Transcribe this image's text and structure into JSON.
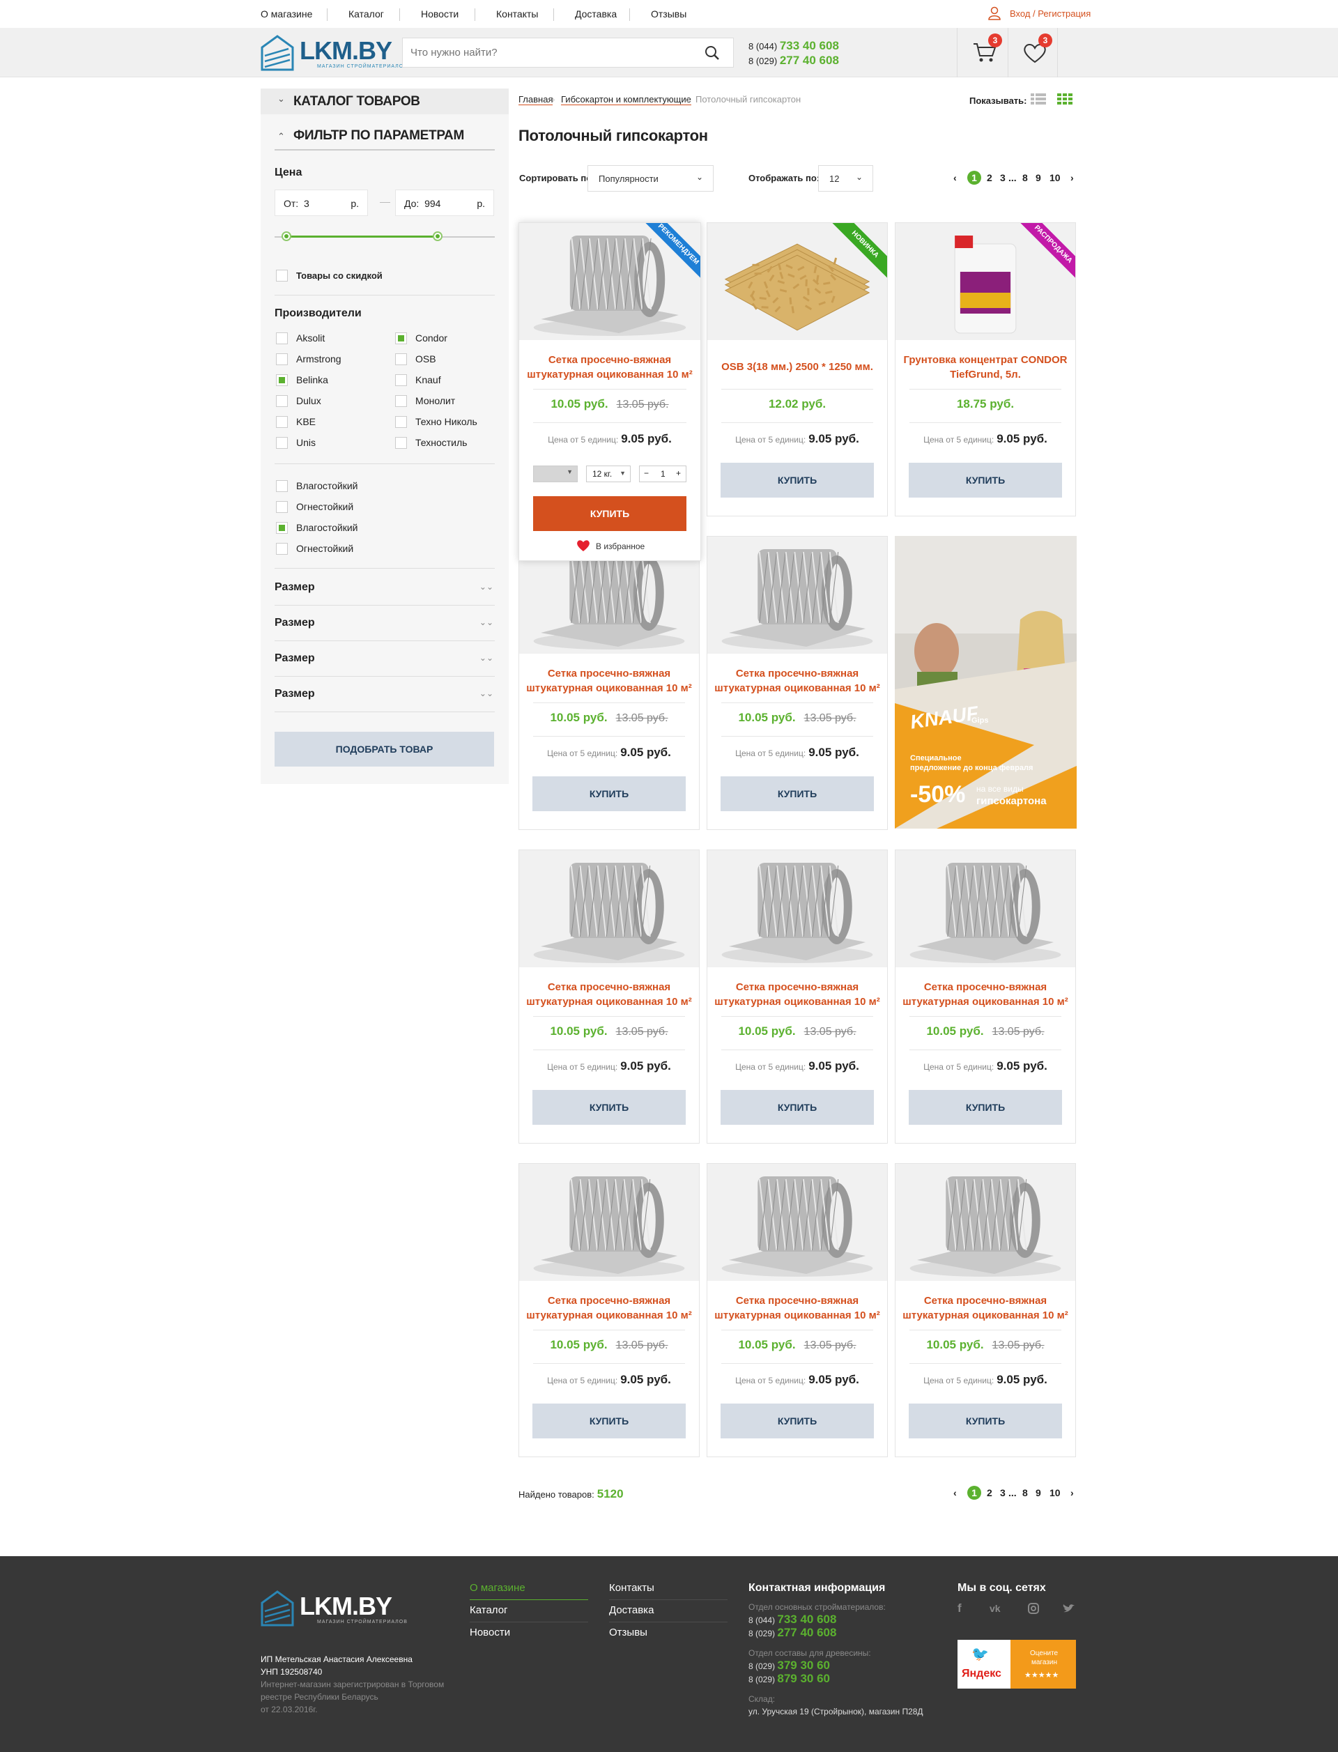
{
  "nav": {
    "items": [
      "О магазине",
      "Каталог",
      "Новости",
      "Контакты",
      "Доставка",
      "Отзывы"
    ],
    "login": "Вход / Регистрация"
  },
  "header": {
    "logo": "LKM.BY",
    "logo_sub": "МАГАЗИН СТРОЙМАТЕРИАЛОВ",
    "search_placeholder": "Что нужно найти?",
    "phone1_code": "8 (044)",
    "phone1_num": "733 40 608",
    "phone2_code": "8 (029)",
    "phone2_num": "277 40 608",
    "cart_count": "3",
    "fav_count": "3"
  },
  "sidebar": {
    "catalog_title": "КАТАЛОГ ТОВАРОВ",
    "filter_title": "ФИЛЬТР ПО ПАРАМЕТРАМ",
    "price_title": "Цена",
    "price_from_label": "От:",
    "price_from": "3",
    "price_to_label": "До:",
    "price_to": "994",
    "currency": "р.",
    "discount_label": "Товары со скидкой",
    "makers_title": "Производители",
    "makers_left": [
      {
        "name": "Aksolit",
        "on": false
      },
      {
        "name": "Armstrong",
        "on": false
      },
      {
        "name": "Belinka",
        "on": true
      },
      {
        "name": "Dulux",
        "on": false
      },
      {
        "name": "KBE",
        "on": false
      },
      {
        "name": "Unis",
        "on": false
      }
    ],
    "makers_right": [
      {
        "name": "Condor",
        "on": true
      },
      {
        "name": "OSB",
        "on": false
      },
      {
        "name": "Knauf",
        "on": false
      },
      {
        "name": "Монолит",
        "on": false
      },
      {
        "name": "Техно Николь",
        "on": false
      },
      {
        "name": "Техностиль",
        "on": false
      }
    ],
    "props": [
      {
        "name": "Влагостойкий",
        "on": false
      },
      {
        "name": "Огнестойкий",
        "on": false
      },
      {
        "name": "Влагостойкий",
        "on": true
      },
      {
        "name": "Огнестойкий",
        "on": false
      }
    ],
    "size_rows": [
      "Размер",
      "Размер",
      "Размер",
      "Размер"
    ],
    "pick_button": "ПОДОБРАТЬ ТОВАР"
  },
  "breadcrumbs": [
    "Главная",
    "Гибсокартон и комплектующие",
    "Потолочный гипсокартон"
  ],
  "show_label": "Показывать:",
  "page_title": "Потолочный гипсокартон",
  "sort_label": "Сортировать по:",
  "sort_value": "Популярности",
  "per_page_label": "Отображать по:",
  "per_page_value": "12",
  "pagination": {
    "prev": "‹",
    "pages": [
      "1",
      "2",
      "3",
      "...",
      "8",
      "9",
      "10"
    ],
    "next": "›",
    "current": "1"
  },
  "common": {
    "bulk_label": "Цена от 5 единиц:",
    "buy": "КУПИТЬ"
  },
  "hover": {
    "variant": "",
    "weight": "12 кг.",
    "qty": "1",
    "minus": "−",
    "plus": "+",
    "buy": "КУПИТЬ",
    "fav": "В избранное"
  },
  "products": [
    {
      "name": "Сетка просечно-вяжная штукатурная оцикованная 10 м²",
      "price": "10.05 руб.",
      "old": "13.05 руб.",
      "bulk": "9.05 руб.",
      "ribbon": "Рекомендуем",
      "ribbon_color": "#1e7fd6",
      "img": "mesh"
    },
    {
      "name": "OSB 3(18 мм.) 2500 * 1250 мм.",
      "price": "12.02 руб.",
      "old": "",
      "bulk": "9.05 руб.",
      "ribbon": "Новинка",
      "ribbon_color": "#3aa823",
      "img": "osb"
    },
    {
      "name": "Грунтовка концентрат CONDOR TiefGrund, 5л.",
      "price": "18.75 руб.",
      "old": "",
      "bulk": "9.05 руб.",
      "ribbon": "Распродажа",
      "ribbon_color": "#c21aa8",
      "img": "can"
    },
    {
      "name": "Сетка просечно-вяжная штукатурная оцикованная 10 м²",
      "price": "10.05 руб.",
      "old": "13.05 руб.",
      "bulk": "9.05 руб.",
      "ribbon": "",
      "img": "mesh"
    },
    {
      "name": "Сетка просечно-вяжная штукатурная оцикованная 10 м²",
      "price": "10.05 руб.",
      "old": "13.05 руб.",
      "bulk": "9.05 руб.",
      "ribbon": "",
      "img": "mesh"
    },
    {
      "name": "Сетка просечно-вяжная штукатурная оцикованная 10 м²",
      "price": "10.05 руб.",
      "old": "13.05 руб.",
      "bulk": "9.05 руб.",
      "ribbon": "",
      "img": "mesh"
    },
    {
      "name": "Сетка просечно-вяжная штукатурная оцикованная 10 м²",
      "price": "10.05 руб.",
      "old": "13.05 руб.",
      "bulk": "9.05 руб.",
      "ribbon": "",
      "img": "mesh"
    },
    {
      "name": "Сетка просечно-вяжная штукатурная оцикованная 10 м²",
      "price": "10.05 руб.",
      "old": "13.05 руб.",
      "bulk": "9.05 руб.",
      "ribbon": "",
      "img": "mesh"
    },
    {
      "name": "Сетка просечно-вяжная штукатурная оцикованная 10 м²",
      "price": "10.05 руб.",
      "old": "13.05 руб.",
      "bulk": "9.05 руб.",
      "ribbon": "",
      "img": "mesh"
    },
    {
      "name": "Сетка просечно-вяжная штукатурная оцикованная 10 м²",
      "price": "10.05 руб.",
      "old": "13.05 руб.",
      "bulk": "9.05 руб.",
      "ribbon": "",
      "img": "mesh"
    },
    {
      "name": "Сетка просечно-вяжная штукатурная оцикованная 10 м²",
      "price": "10.05 руб.",
      "old": "13.05 руб.",
      "bulk": "9.05 руб.",
      "ribbon": "",
      "img": "mesh"
    }
  ],
  "banner": {
    "brand": "KNAUF",
    "brand_sub": "Gips",
    "line1": "Специальное",
    "line2": "предложение до конца февраля",
    "discount": "-50%",
    "line3": "на все виды",
    "line4": "гипсокартона"
  },
  "found": {
    "label": "Найдено товаров:",
    "count": "5120"
  },
  "footer": {
    "col1": [
      "О магазине",
      "Каталог",
      "Новости"
    ],
    "col2": [
      "Контакты",
      "Доставка",
      "Отзывы"
    ],
    "legal1": "ИП Метельская Анастасия Алексеевна",
    "legal2": "УНП 192508740",
    "legal3": "Интернет-магазин зарегистрирован в Торговом",
    "legal4": "реестре Республики Беларусь",
    "legal5": "от 22.03.2016г.",
    "contact_title": "Контактная информация",
    "dept1": "Отдел основных стройматериалов:",
    "d1p1_code": "8 (044)",
    "d1p1": "733 40 608",
    "d1p2_code": "8 (029)",
    "d1p2": "277 40 608",
    "dept2": "Отдел составы для древесины:",
    "d2p1_code": "8 (029)",
    "d2p1": "379 30 60",
    "d2p2_code": "8 (029)",
    "d2p2": "879 30 60",
    "warehouse_label": "Склад:",
    "warehouse": "ул. Уручская 19 (Стройрынок), магазин П28Д",
    "social_title": "Мы в соц. сетях",
    "yandex": "Яндекс",
    "rate1": "Оцените",
    "rate2": "магазин",
    "stars": "★★★★★"
  }
}
